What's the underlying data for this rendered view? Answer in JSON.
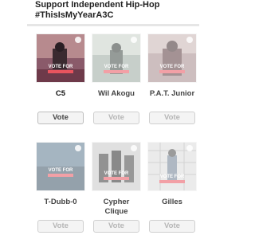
{
  "header": {
    "line1": "Support Independent Hip-Hop",
    "line2": "#ThisIsMyYearA3C"
  },
  "artists": [
    {
      "name": "C5",
      "vote_label": "Vote",
      "active": true
    },
    {
      "name": "Wil Akogu",
      "vote_label": "Vote",
      "active": false
    },
    {
      "name": "P.A.T. Junior",
      "vote_label": "Vote",
      "active": false
    },
    {
      "name": "T-Dubb-0",
      "vote_label": "Vote",
      "active": false
    },
    {
      "name": "Cypher Clique",
      "vote_label": "Vote",
      "active": false
    },
    {
      "name": "Gilles",
      "vote_label": "Vote",
      "active": false
    }
  ],
  "colors": {
    "accent": "#e8545e",
    "text": "#222222",
    "muted": "#b5b5b5"
  }
}
